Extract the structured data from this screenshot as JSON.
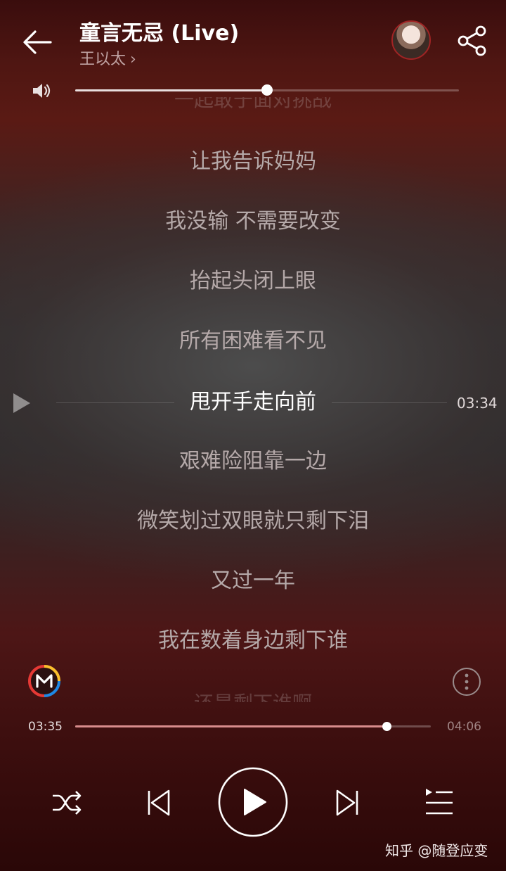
{
  "header": {
    "title": "童言无忌 (Live)",
    "artist": "王以太",
    "artist_chevron": "›"
  },
  "volume": {
    "level": 0.5
  },
  "lyrics": {
    "partial_top": "一起敢于面对挑战",
    "lines": [
      "让我告诉妈妈",
      "我没输 不需要改变",
      "抬起头闭上眼",
      "所有困难看不见",
      "甩开手走向前",
      "艰难险阻靠一边",
      "微笑划过双眼就只剩下泪",
      "又过一年",
      "我在数着身边剩下谁"
    ],
    "current_index": 4,
    "partial_bottom": "还是剩下谁啊",
    "seek_time": "03:34"
  },
  "progress": {
    "current": "03:35",
    "total": "04:06",
    "fraction": 0.875
  },
  "icons": {
    "back": "back-arrow-icon",
    "share": "share-icon",
    "volume": "volume-icon",
    "more": "more-vertical-icon",
    "shuffle": "shuffle-icon",
    "prev": "previous-track-icon",
    "play": "play-icon",
    "next": "next-track-icon",
    "playlist": "playlist-icon"
  },
  "colors": {
    "accent": "#d88c8c",
    "logo_red": "#e53935",
    "logo_blue": "#1e88e5",
    "logo_yellow": "#fbc02d"
  },
  "watermark": "知乎 @随登应变"
}
